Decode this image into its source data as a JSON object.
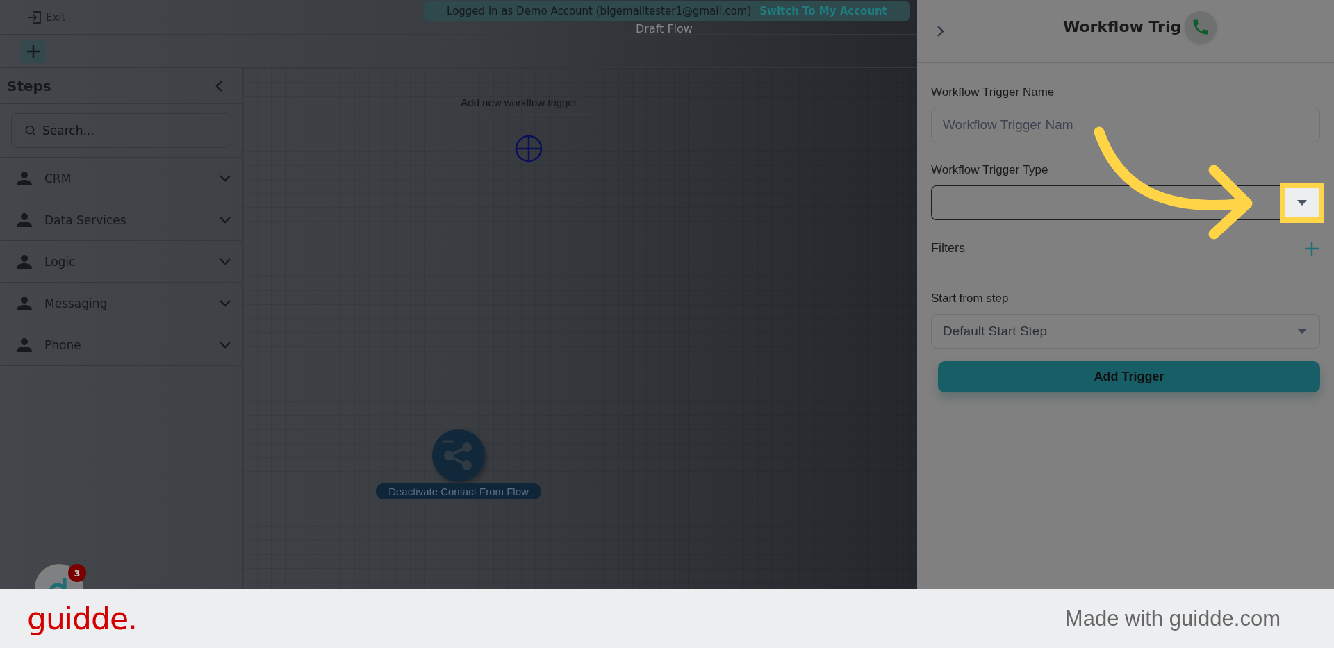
{
  "top_bar": {
    "exit_label": "Exit",
    "title": "Draft Flow",
    "banner": {
      "text": "Logged in as Demo Account (bigemailtester1@gmail.com)",
      "link": "Switch To My Account"
    }
  },
  "sidebar": {
    "title": "Steps",
    "search": {
      "placeholder": "Search..."
    },
    "items": [
      {
        "label": "CRM"
      },
      {
        "label": "Data Services"
      },
      {
        "label": "Logic"
      },
      {
        "label": "Messaging"
      },
      {
        "label": "Phone"
      }
    ]
  },
  "canvas": {
    "trigger_button": "Add new workflow trigger",
    "nodes": [
      {
        "label": "Deactivate Contact From Flow"
      }
    ]
  },
  "chat_badge": {
    "count": "3"
  },
  "panel": {
    "title": "Workflow Trig",
    "fields": [
      {
        "kind": "text",
        "label": "Workflow Trigger Name",
        "placeholder": "Workflow Trigger Nam"
      },
      {
        "kind": "select",
        "label": "Workflow Trigger Type",
        "highlighted": true
      },
      {
        "kind": "add",
        "label": "Filters"
      },
      {
        "kind": "select",
        "label": "Start from step",
        "value": "Default Start Step"
      }
    ],
    "submit": "Add Trigger"
  },
  "footer": {
    "logo": "guidde.",
    "credit": "Made with guidde.com"
  }
}
